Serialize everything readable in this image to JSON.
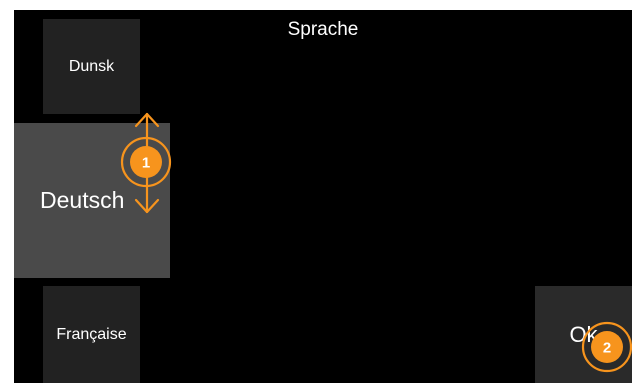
{
  "screen": {
    "title": "Sprache"
  },
  "languages": [
    {
      "label": "Dunsk"
    },
    {
      "label": "Deutsch",
      "selected": true
    },
    {
      "label": "Française"
    }
  ],
  "ok_button": {
    "label": "Ok"
  },
  "annotations": [
    {
      "number": "1",
      "icon": "up-down-arrow-icon"
    },
    {
      "number": "2",
      "icon": "tap-circle-icon"
    }
  ],
  "colors": {
    "accent": "#F7941D",
    "screen_background": "#000000",
    "selected_item": "#4A4A4A",
    "item": "#222222"
  }
}
